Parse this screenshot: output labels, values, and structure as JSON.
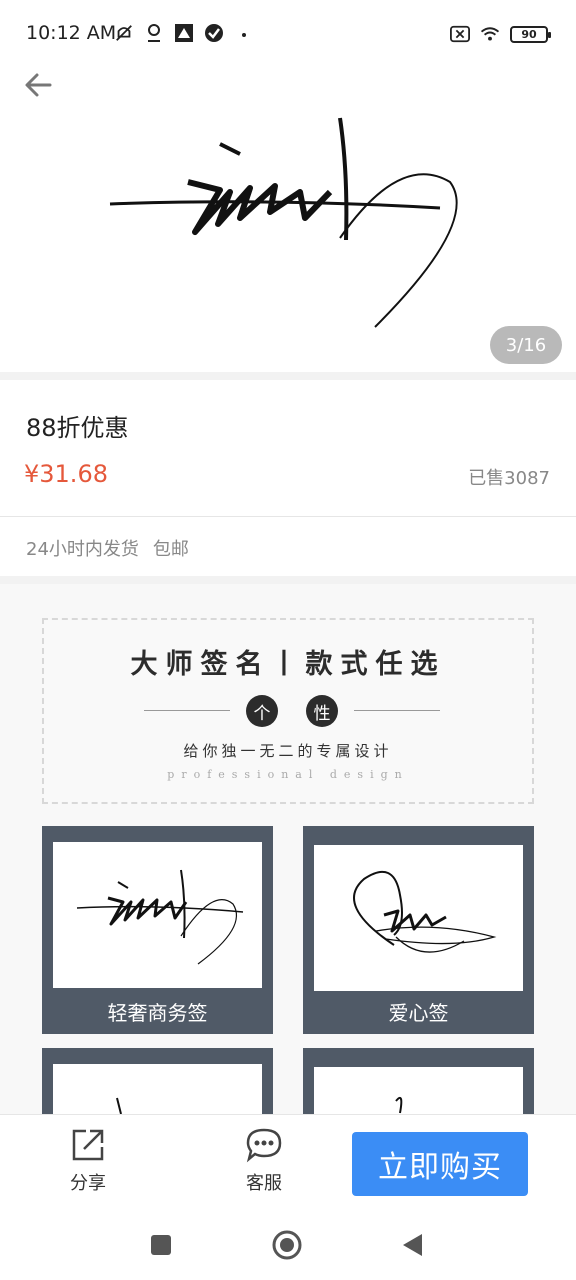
{
  "status_bar": {
    "time": "10:12 AM",
    "battery": "90",
    "icons": [
      "muted-icon",
      "location-icon",
      "app-icon",
      "check-icon",
      "dot-icon",
      "sim-x-icon",
      "wifi-icon",
      "battery-icon"
    ]
  },
  "gallery": {
    "pager": "3/16"
  },
  "product": {
    "title": "88折优惠",
    "price": "¥31.68",
    "sold": "已售3087",
    "shipping": "24小时内发货",
    "free_shipping": "包邮"
  },
  "detail": {
    "banner_title": "大师签名丨款式任选",
    "dot_1": "个",
    "dot_2": "性",
    "subtitle": "给你独一无二的专属设计",
    "english": "professional design",
    "cards": [
      {
        "label": "轻奢商务签"
      },
      {
        "label": "爱心签"
      },
      {
        "label": ""
      },
      {
        "label": ""
      }
    ]
  },
  "bottom_bar": {
    "share_label": "分享",
    "service_label": "客服",
    "buy_label": "立即购买",
    "accent": "#3b8df5"
  },
  "colors": {
    "price": "#e5583b",
    "card_bg": "#505a67"
  }
}
